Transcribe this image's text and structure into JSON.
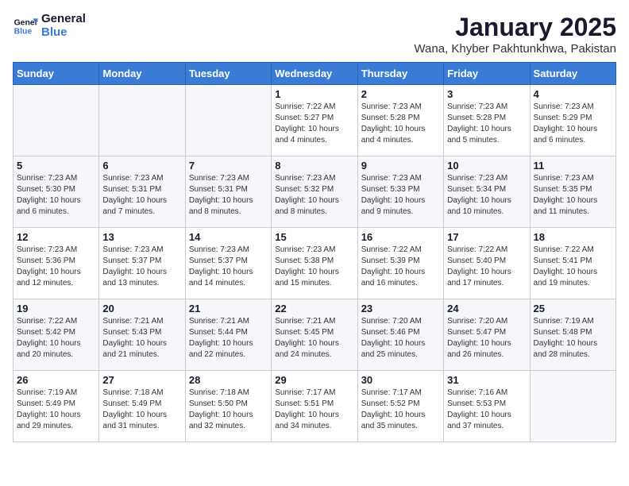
{
  "header": {
    "logo_line1": "General",
    "logo_line2": "Blue",
    "title": "January 2025",
    "subtitle": "Wana, Khyber Pakhtunkhwa, Pakistan"
  },
  "days_of_week": [
    "Sunday",
    "Monday",
    "Tuesday",
    "Wednesday",
    "Thursday",
    "Friday",
    "Saturday"
  ],
  "weeks": [
    {
      "days": [
        {
          "number": "",
          "info": ""
        },
        {
          "number": "",
          "info": ""
        },
        {
          "number": "",
          "info": ""
        },
        {
          "number": "1",
          "info": "Sunrise: 7:22 AM\nSunset: 5:27 PM\nDaylight: 10 hours\nand 4 minutes."
        },
        {
          "number": "2",
          "info": "Sunrise: 7:23 AM\nSunset: 5:28 PM\nDaylight: 10 hours\nand 4 minutes."
        },
        {
          "number": "3",
          "info": "Sunrise: 7:23 AM\nSunset: 5:28 PM\nDaylight: 10 hours\nand 5 minutes."
        },
        {
          "number": "4",
          "info": "Sunrise: 7:23 AM\nSunset: 5:29 PM\nDaylight: 10 hours\nand 6 minutes."
        }
      ]
    },
    {
      "days": [
        {
          "number": "5",
          "info": "Sunrise: 7:23 AM\nSunset: 5:30 PM\nDaylight: 10 hours\nand 6 minutes."
        },
        {
          "number": "6",
          "info": "Sunrise: 7:23 AM\nSunset: 5:31 PM\nDaylight: 10 hours\nand 7 minutes."
        },
        {
          "number": "7",
          "info": "Sunrise: 7:23 AM\nSunset: 5:31 PM\nDaylight: 10 hours\nand 8 minutes."
        },
        {
          "number": "8",
          "info": "Sunrise: 7:23 AM\nSunset: 5:32 PM\nDaylight: 10 hours\nand 8 minutes."
        },
        {
          "number": "9",
          "info": "Sunrise: 7:23 AM\nSunset: 5:33 PM\nDaylight: 10 hours\nand 9 minutes."
        },
        {
          "number": "10",
          "info": "Sunrise: 7:23 AM\nSunset: 5:34 PM\nDaylight: 10 hours\nand 10 minutes."
        },
        {
          "number": "11",
          "info": "Sunrise: 7:23 AM\nSunset: 5:35 PM\nDaylight: 10 hours\nand 11 minutes."
        }
      ]
    },
    {
      "days": [
        {
          "number": "12",
          "info": "Sunrise: 7:23 AM\nSunset: 5:36 PM\nDaylight: 10 hours\nand 12 minutes."
        },
        {
          "number": "13",
          "info": "Sunrise: 7:23 AM\nSunset: 5:37 PM\nDaylight: 10 hours\nand 13 minutes."
        },
        {
          "number": "14",
          "info": "Sunrise: 7:23 AM\nSunset: 5:37 PM\nDaylight: 10 hours\nand 14 minutes."
        },
        {
          "number": "15",
          "info": "Sunrise: 7:23 AM\nSunset: 5:38 PM\nDaylight: 10 hours\nand 15 minutes."
        },
        {
          "number": "16",
          "info": "Sunrise: 7:22 AM\nSunset: 5:39 PM\nDaylight: 10 hours\nand 16 minutes."
        },
        {
          "number": "17",
          "info": "Sunrise: 7:22 AM\nSunset: 5:40 PM\nDaylight: 10 hours\nand 17 minutes."
        },
        {
          "number": "18",
          "info": "Sunrise: 7:22 AM\nSunset: 5:41 PM\nDaylight: 10 hours\nand 19 minutes."
        }
      ]
    },
    {
      "days": [
        {
          "number": "19",
          "info": "Sunrise: 7:22 AM\nSunset: 5:42 PM\nDaylight: 10 hours\nand 20 minutes."
        },
        {
          "number": "20",
          "info": "Sunrise: 7:21 AM\nSunset: 5:43 PM\nDaylight: 10 hours\nand 21 minutes."
        },
        {
          "number": "21",
          "info": "Sunrise: 7:21 AM\nSunset: 5:44 PM\nDaylight: 10 hours\nand 22 minutes."
        },
        {
          "number": "22",
          "info": "Sunrise: 7:21 AM\nSunset: 5:45 PM\nDaylight: 10 hours\nand 24 minutes."
        },
        {
          "number": "23",
          "info": "Sunrise: 7:20 AM\nSunset: 5:46 PM\nDaylight: 10 hours\nand 25 minutes."
        },
        {
          "number": "24",
          "info": "Sunrise: 7:20 AM\nSunset: 5:47 PM\nDaylight: 10 hours\nand 26 minutes."
        },
        {
          "number": "25",
          "info": "Sunrise: 7:19 AM\nSunset: 5:48 PM\nDaylight: 10 hours\nand 28 minutes."
        }
      ]
    },
    {
      "days": [
        {
          "number": "26",
          "info": "Sunrise: 7:19 AM\nSunset: 5:49 PM\nDaylight: 10 hours\nand 29 minutes."
        },
        {
          "number": "27",
          "info": "Sunrise: 7:18 AM\nSunset: 5:49 PM\nDaylight: 10 hours\nand 31 minutes."
        },
        {
          "number": "28",
          "info": "Sunrise: 7:18 AM\nSunset: 5:50 PM\nDaylight: 10 hours\nand 32 minutes."
        },
        {
          "number": "29",
          "info": "Sunrise: 7:17 AM\nSunset: 5:51 PM\nDaylight: 10 hours\nand 34 minutes."
        },
        {
          "number": "30",
          "info": "Sunrise: 7:17 AM\nSunset: 5:52 PM\nDaylight: 10 hours\nand 35 minutes."
        },
        {
          "number": "31",
          "info": "Sunrise: 7:16 AM\nSunset: 5:53 PM\nDaylight: 10 hours\nand 37 minutes."
        },
        {
          "number": "",
          "info": ""
        }
      ]
    }
  ]
}
